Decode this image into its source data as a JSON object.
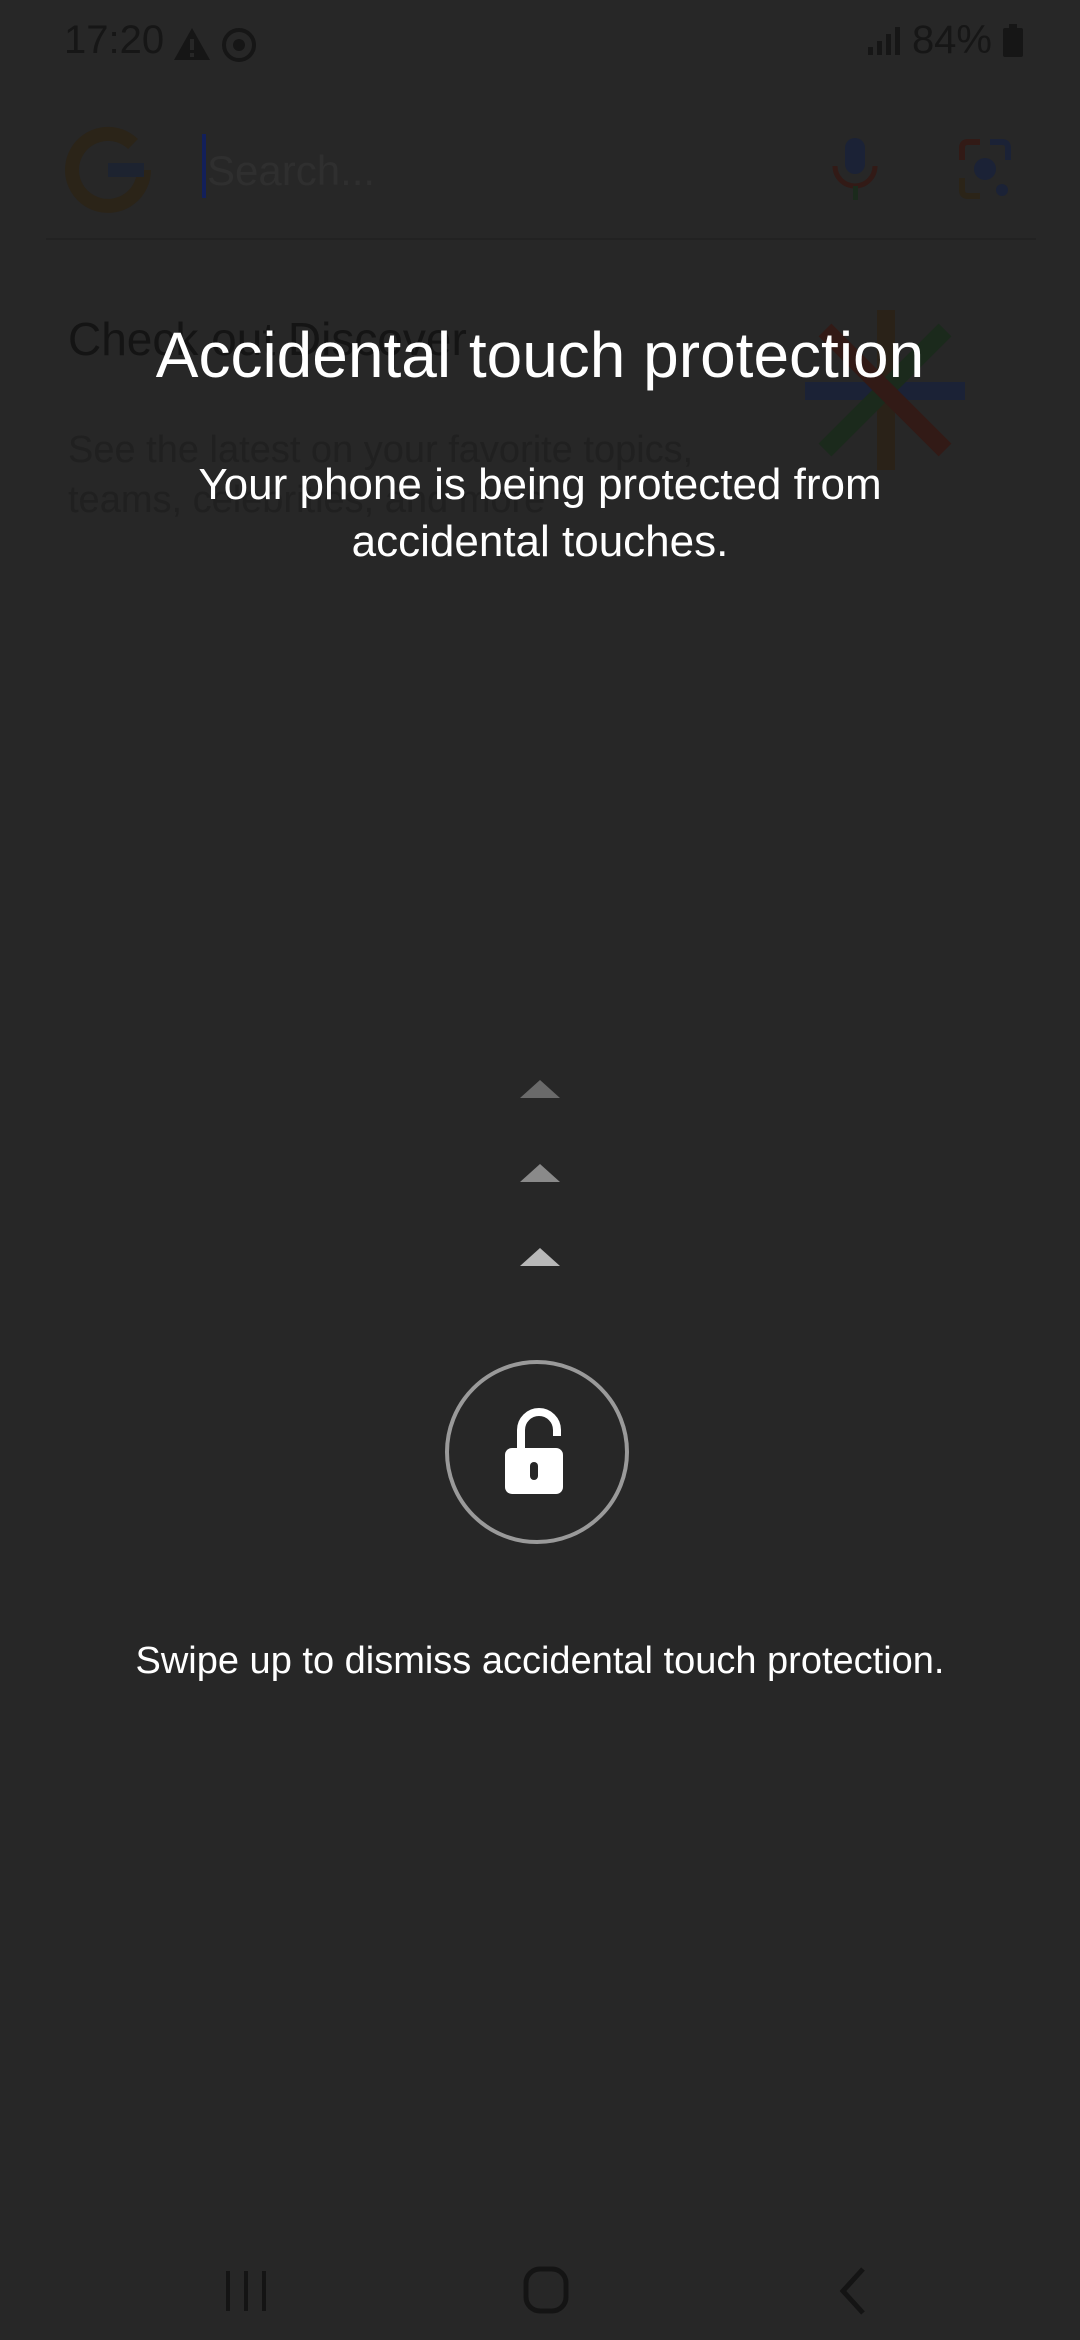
{
  "status_bar": {
    "time": "17:20",
    "battery": "84%"
  },
  "search": {
    "placeholder": "Search..."
  },
  "discover": {
    "title": "Check out Discover",
    "description": "See the latest on your favorite topics, teams, celebrities, and more"
  },
  "protection": {
    "title": "Accidental touch protection",
    "message": "Your phone is being protected from accidental touches.",
    "dismiss_hint": "Swipe up to dismiss accidental touch protection."
  },
  "icons": {
    "status": [
      "warning-icon",
      "chrome-icon",
      "signal-icon",
      "battery-icon"
    ],
    "search": [
      "google-logo",
      "mic-icon",
      "lens-icon"
    ],
    "overlay": [
      "chevron-up-icon",
      "unlock-icon"
    ],
    "nav": [
      "recents-icon",
      "home-icon",
      "back-icon"
    ]
  },
  "colors": {
    "background": "#272727",
    "overlay_text": "#ffffff",
    "ring": "#9a9a9a"
  }
}
